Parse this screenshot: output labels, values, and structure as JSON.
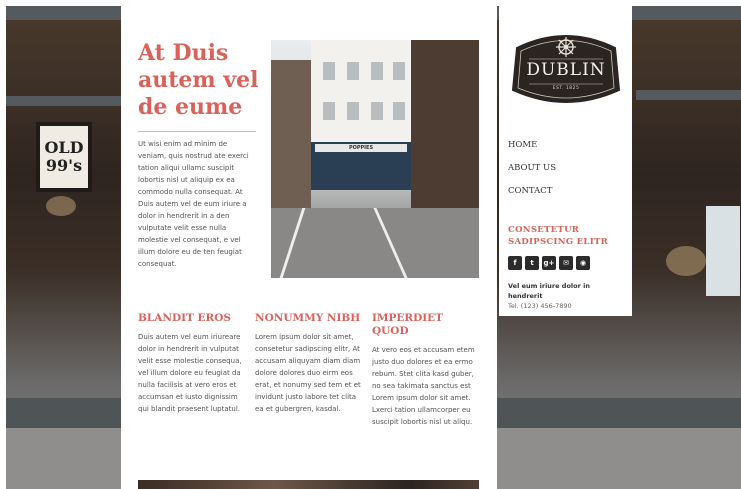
{
  "background": {
    "frame_text": "OLD\n99's"
  },
  "main": {
    "headline": "At Duis autem vel de eume",
    "intro": "Ut wisi enim ad minim de veniam, quis nostrud ate exerci tation aliqui ullamc suscipit lobortis nisl ut aliquip ex ea commodo nulla consequat. At Duis autem vel de eum iriure a dolor in hendrerit in a den vulputate velit esse nulla molestie vel consequat, e vel illum dolore eu de ten feugiat consequat.",
    "photo_sign": "POPPIES",
    "columns": [
      {
        "title": "BLANDIT EROS",
        "text": "Duis autem vel eum iriureare dolor in hendrerit in vulputat velit esse molestie consequa, vel illum dolore eu feugiat da nulla facilisis at vero eros et accumsan et iusto dignissim qui blandit praesent luptatul."
      },
      {
        "title": "NONUMMY NIBH",
        "text": "Lorem ipsum dolor sit amet, consetetur sadipscing elitr, At accusam aliquyam diam diam dolore dolores duo eirm eos erat, et nonumy sed tem et et invidunt justo labore tet clita ea et gubergren, kasdal."
      },
      {
        "title": "IMPERDIET QUOD",
        "text": "At vero eos et accusam etem justo duo dolores et ea ermo rebum. Stet clita kasd guber, no sea takimata sanctus est Lorem ipsum dolor sit amet. Lxerci tation ullamcorper eu suscipit lobortis nisl ut aliqu."
      }
    ]
  },
  "sidebar": {
    "logo_text": "DUBLIN",
    "logo_est": "EST. 1825",
    "nav": [
      "HOME",
      "ABOUT US",
      "CONTACT"
    ],
    "section_title": "CONSETETUR SADIPSCING ELITR",
    "socials": [
      {
        "icon": "facebook-icon",
        "glyph": "f"
      },
      {
        "icon": "twitter-icon",
        "glyph": "t"
      },
      {
        "icon": "google-plus-icon",
        "glyph": "g+"
      },
      {
        "icon": "email-icon",
        "glyph": "✉"
      },
      {
        "icon": "feed-icon",
        "glyph": "◉"
      }
    ],
    "address_line": "Vel eum iriure dolor in hendrerit",
    "phone": "Tel. (123) 456-7890"
  },
  "colors": {
    "accent": "#d9625a",
    "logo_bg": "#2b2522"
  }
}
